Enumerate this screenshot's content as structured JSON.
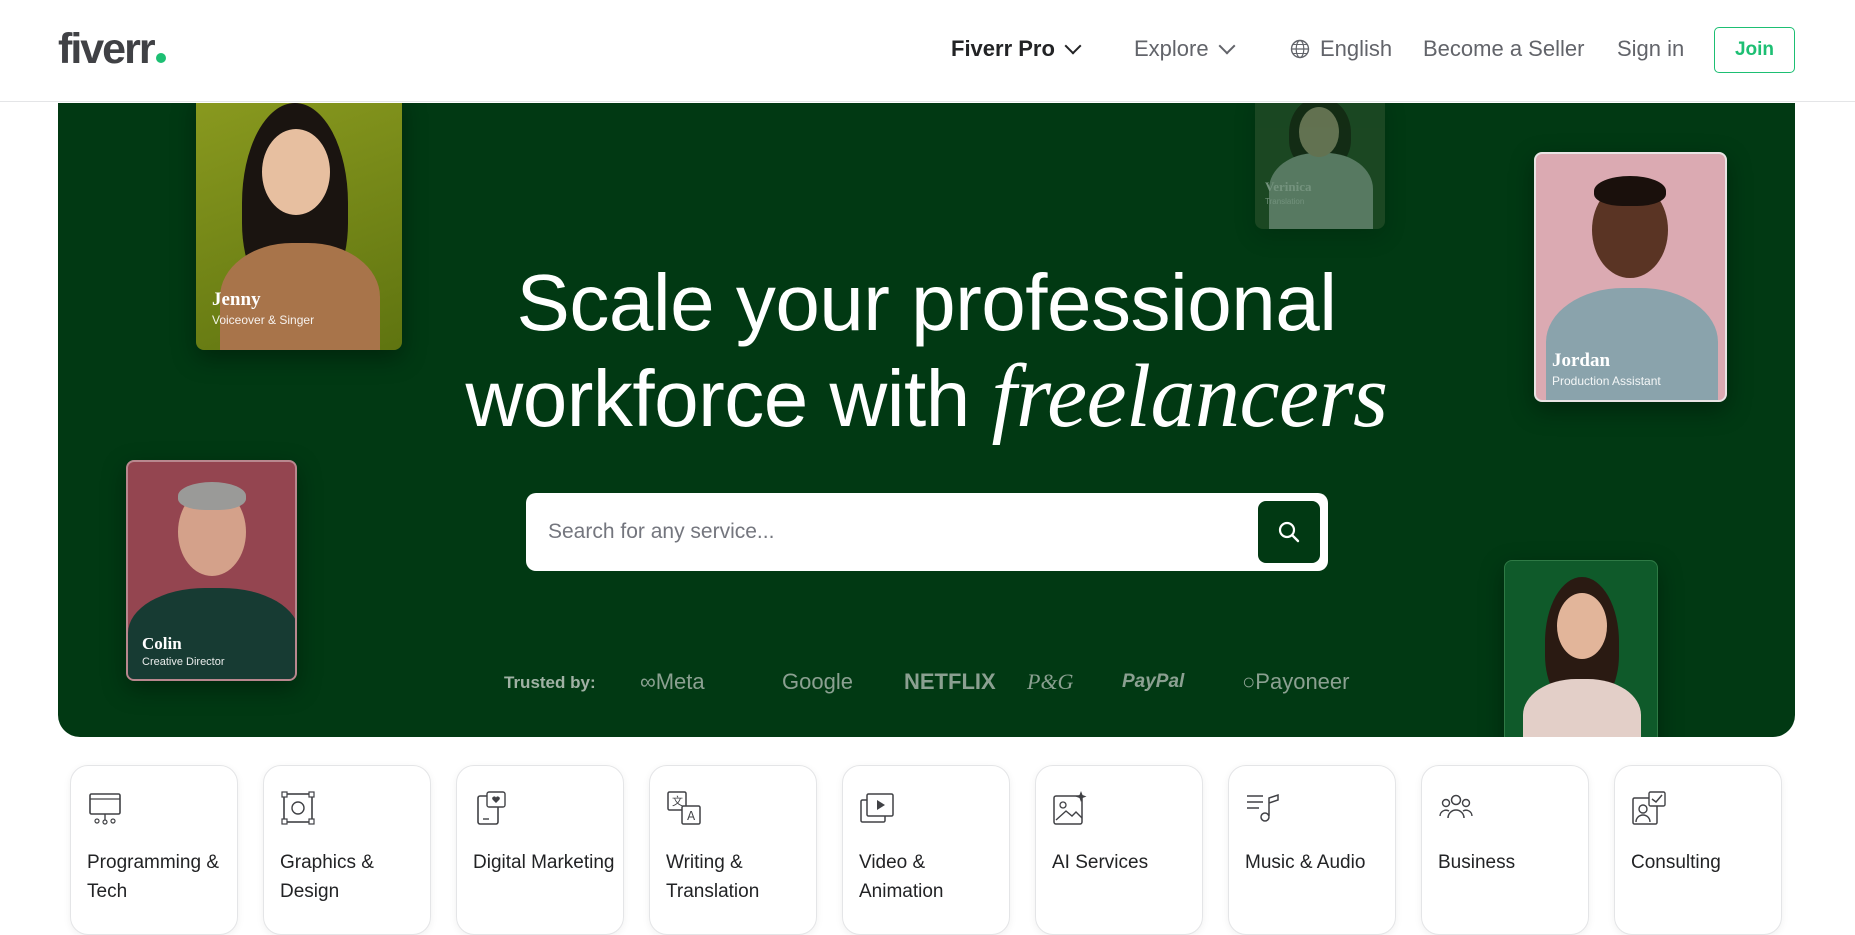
{
  "header": {
    "logo": "fiverr",
    "nav": {
      "fiverr_pro": "Fiverr Pro",
      "explore": "Explore",
      "language": "English",
      "become_seller": "Become a Seller",
      "sign_in": "Sign in",
      "join": "Join"
    }
  },
  "hero": {
    "headline_line1": "Scale your professional",
    "headline_line2_plain": "workforce with",
    "headline_line2_italic": "freelancers",
    "search": {
      "placeholder": "Search for any service..."
    },
    "trusted_label": "Trusted by:",
    "brands": [
      "Meta",
      "Google",
      "NETFLIX",
      "P&G",
      "PayPal",
      "Payoneer"
    ],
    "profiles": [
      {
        "name": "Jenny",
        "role": "Voiceover & Singer"
      },
      {
        "name": "Verinica",
        "role": "Translation"
      },
      {
        "name": "Jordan",
        "role": "Production Assistant"
      },
      {
        "name": "Colin",
        "role": "Creative Director"
      }
    ]
  },
  "categories": [
    {
      "label": "Programming & Tech",
      "icon": "monitor-icon"
    },
    {
      "label": "Graphics & Design",
      "icon": "design-icon"
    },
    {
      "label": "Digital Marketing",
      "icon": "phone-heart-icon"
    },
    {
      "label": "Writing & Translation",
      "icon": "translate-icon"
    },
    {
      "label": "Video & Animation",
      "icon": "video-icon"
    },
    {
      "label": "AI Services",
      "icon": "ai-image-icon"
    },
    {
      "label": "Music & Audio",
      "icon": "music-icon"
    },
    {
      "label": "Business",
      "icon": "people-icon"
    },
    {
      "label": "Consulting",
      "icon": "consulting-icon"
    }
  ],
  "colors": {
    "brand_green": "#1dbf73",
    "hero_bg": "#013913",
    "text_dark": "#222325"
  }
}
